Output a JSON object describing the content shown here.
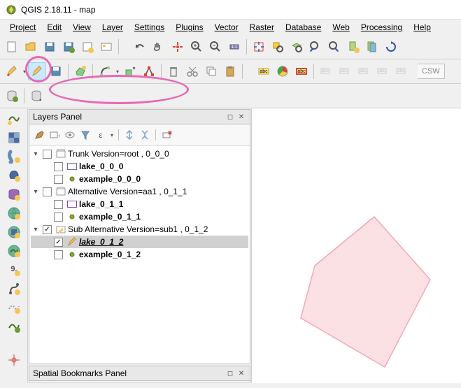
{
  "window": {
    "title": "QGIS 2.18.11 - map"
  },
  "menubar": {
    "items": [
      "Project",
      "Edit",
      "View",
      "Layer",
      "Settings",
      "Plugins",
      "Vector",
      "Raster",
      "Database",
      "Web",
      "Processing",
      "Help"
    ]
  },
  "panels": {
    "layers": {
      "title": "Layers Panel"
    },
    "bookmarks": {
      "title": "Spatial Bookmarks Panel"
    }
  },
  "tree": {
    "groups": [
      {
        "name": "Trunk Version=root , 0_0_0",
        "checked": false,
        "layers": [
          {
            "name": "lake_0_0_0",
            "bold": true,
            "swatch_fill": "#ffffff",
            "swatch_stroke": "#776e9e"
          },
          {
            "name": "example_0_0_0",
            "bold": true,
            "point_color": "#8aa63a"
          }
        ]
      },
      {
        "name": "Alternative Version=aa1 , 0_1_1",
        "checked": false,
        "layers": [
          {
            "name": "lake_0_1_1",
            "bold": true,
            "swatch_fill": "#ffffff",
            "swatch_stroke": "#8a3fb0"
          },
          {
            "name": "example_0_1_1",
            "bold": true,
            "point_color": "#8aa63a"
          }
        ]
      },
      {
        "name": "Sub Alternative Version=sub1 , 0_1_2",
        "checked": true,
        "edit": true,
        "layers": [
          {
            "name": "lake_0_1_2",
            "italic": true,
            "selected": true,
            "editing": true,
            "swatch_fill": "#fbe0e4",
            "swatch_stroke": "#f4a9b5"
          },
          {
            "name": "example_0_1_2",
            "bold": true,
            "point_color": "#8aa63a"
          }
        ]
      }
    ]
  },
  "toolbar_labels": {
    "csw": "CSW"
  }
}
